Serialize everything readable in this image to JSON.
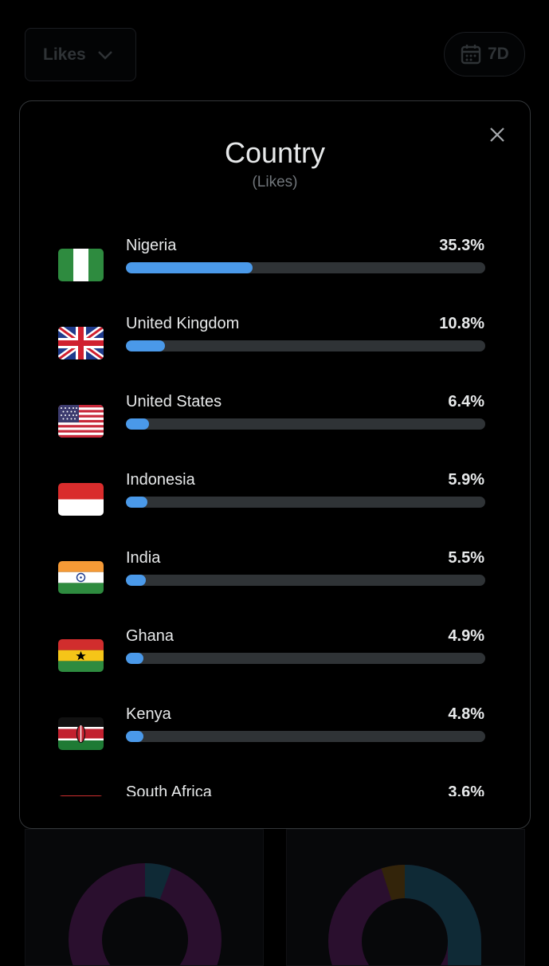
{
  "header": {
    "metric_label": "Likes",
    "range_label": "7D"
  },
  "modal": {
    "title": "Country",
    "subtitle": "(Likes)"
  },
  "countries": [
    {
      "name": "Nigeria",
      "percent_label": "35.3%",
      "percent": 35.3,
      "flag": "nigeria-flag-icon"
    },
    {
      "name": "United Kingdom",
      "percent_label": "10.8%",
      "percent": 10.8,
      "flag": "uk-flag-icon"
    },
    {
      "name": "United States",
      "percent_label": "6.4%",
      "percent": 6.4,
      "flag": "us-flag-icon"
    },
    {
      "name": "Indonesia",
      "percent_label": "5.9%",
      "percent": 5.9,
      "flag": "indonesia-flag-icon"
    },
    {
      "name": "India",
      "percent_label": "5.5%",
      "percent": 5.5,
      "flag": "india-flag-icon"
    },
    {
      "name": "Ghana",
      "percent_label": "4.9%",
      "percent": 4.9,
      "flag": "ghana-flag-icon"
    },
    {
      "name": "Kenya",
      "percent_label": "4.8%",
      "percent": 4.8,
      "flag": "kenya-flag-icon"
    },
    {
      "name": "South Africa",
      "percent_label": "3.6%",
      "percent": 3.6,
      "flag": "south-africa-flag-icon"
    }
  ],
  "colors": {
    "bar_fill": "#4a99e9",
    "bar_track": "#2f3336",
    "text_primary": "#e7e9ea",
    "text_secondary": "#71767b"
  }
}
